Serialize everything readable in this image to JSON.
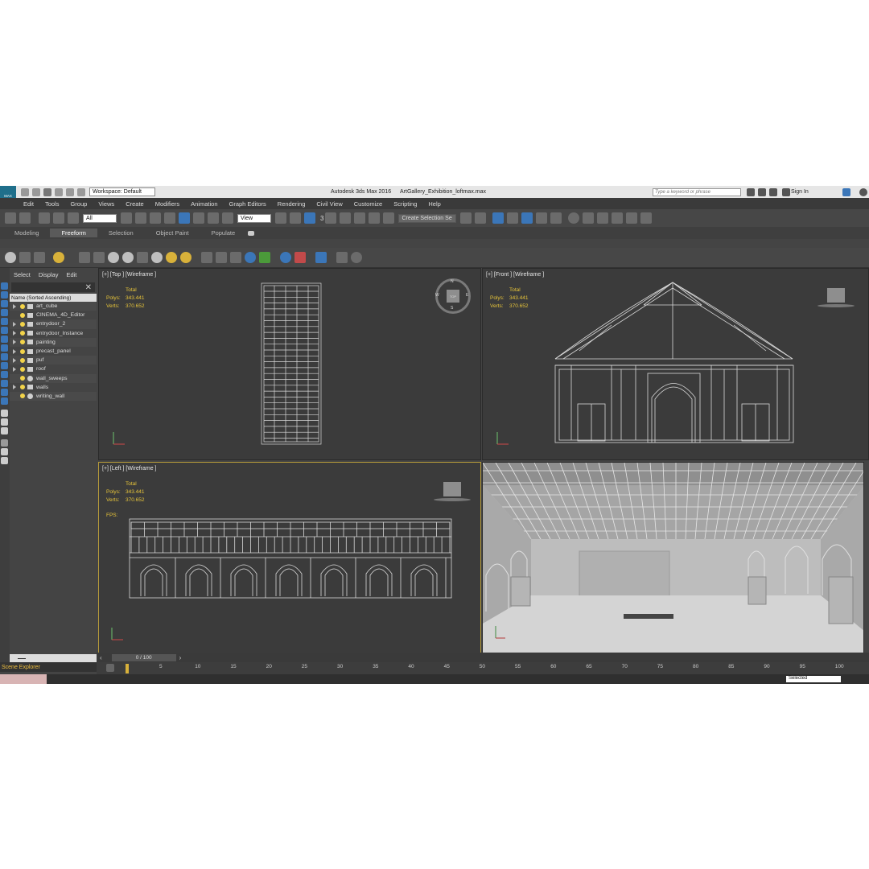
{
  "window": {
    "app_title": "Autodesk 3ds Max 2016",
    "file_name": "ArtGallery_Exhibition_loftmax.max",
    "logo_text": "MAX",
    "workspace": "Workspace: Default",
    "search_placeholder": "Type a keyword or phrase",
    "sign_in": "Sign In"
  },
  "menu": [
    "Edit",
    "Tools",
    "Group",
    "Views",
    "Create",
    "Modifiers",
    "Animation",
    "Graph Editors",
    "Rendering",
    "Civil View",
    "Customize",
    "Scripting",
    "Help"
  ],
  "toolbar": {
    "filter_value": "All",
    "ref_coord_value": "View",
    "ref_coord_3": "3",
    "named_selection_value": "Create Selection Se"
  },
  "ribbon_tabs": [
    "Modeling",
    "Freeform",
    "Selection",
    "Object Paint",
    "Populate"
  ],
  "active_ribbon_tab": "Freeform",
  "explorer": {
    "tabs": [
      "Select",
      "Display",
      "Edit"
    ],
    "header": "Name (Sorted Ascending)",
    "close_glyph": "✕",
    "footer_label": "Scene Explorer",
    "items": [
      {
        "label": "art_cube",
        "expandable": true,
        "type": "layer"
      },
      {
        "label": "CINEMA_4D_Editor",
        "expandable": false,
        "type": "layer"
      },
      {
        "label": "entrydoor_2",
        "expandable": true,
        "type": "layer"
      },
      {
        "label": "entrydoor_Instance",
        "expandable": true,
        "type": "layer"
      },
      {
        "label": "painting",
        "expandable": true,
        "type": "layer"
      },
      {
        "label": "precast_panel",
        "expandable": true,
        "type": "layer"
      },
      {
        "label": "puf",
        "expandable": true,
        "type": "layer"
      },
      {
        "label": "roof",
        "expandable": true,
        "type": "layer"
      },
      {
        "label": "wall_sweeps",
        "expandable": false,
        "type": "sphere"
      },
      {
        "label": "walls",
        "expandable": true,
        "type": "layer"
      },
      {
        "label": "writing_wall",
        "expandable": false,
        "type": "sphere"
      }
    ]
  },
  "viewports": {
    "stats_total": "Total",
    "polys_label": "Polys:",
    "polys_value": "343.441",
    "verts_label": "Verts:",
    "verts_value": "370.652",
    "fps_label": "FPS:",
    "top": {
      "label": "[+] [Top ] [Wireframe ]"
    },
    "front": {
      "label": "[+] [Front ] [Wireframe ]"
    },
    "left": {
      "label": "[+] [Left ] [Wireframe ]"
    },
    "perspective": {
      "label": ""
    }
  },
  "viewcube": {
    "top_label": "TOP",
    "n": "N",
    "s": "S",
    "e": "E",
    "w": "W"
  },
  "timeline": {
    "slider": "0 / 100",
    "ticks": [
      "5",
      "10",
      "15",
      "20",
      "25",
      "30",
      "35",
      "40",
      "45",
      "50",
      "55",
      "60",
      "65",
      "70",
      "75",
      "80",
      "85",
      "90",
      "95",
      "100"
    ]
  },
  "status": {
    "selection_set": "Selected"
  },
  "colors": {
    "accent": "#3b76b8",
    "stats": "#e8c53a",
    "active_viewport_border": "#b59a3a"
  }
}
